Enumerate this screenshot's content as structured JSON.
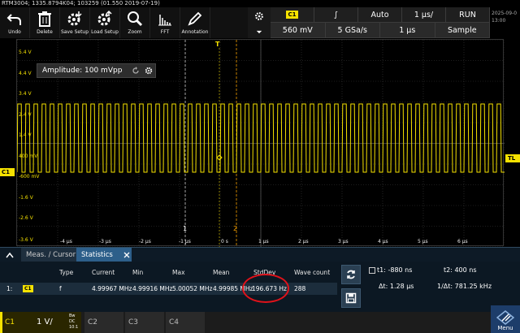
{
  "header": {
    "title": "RTM3004; 1335.8794K04; 103259 (01.550 2019-07-19)"
  },
  "toolbar": {
    "items": [
      {
        "label": "Undo",
        "icon": "undo-icon"
      },
      {
        "label": "Delete",
        "icon": "trash-icon"
      },
      {
        "label": "Save Setup",
        "icon": "save-setup-icon"
      },
      {
        "label": "Load Setup",
        "icon": "load-setup-icon"
      },
      {
        "label": "Zoom",
        "icon": "zoom-icon"
      },
      {
        "label": "FFT",
        "icon": "fft-icon"
      },
      {
        "label": "Annotation",
        "icon": "pen-icon"
      }
    ]
  },
  "settings": {
    "channel": "C1",
    "trigger_slope": "∫",
    "mode": "Auto",
    "time_per_div": "1 µs/",
    "run_state": "RUN",
    "vertical_scale": "560 mV",
    "sample_rate": "5 GSa/s",
    "record_time": "1 µs",
    "acq_mode": "Sample"
  },
  "date": {
    "line1": "2025-09-0",
    "line2": "13:00"
  },
  "plot": {
    "y_labels": [
      "5.4 V",
      "4.4 V",
      "3.4 V",
      "2.4 V",
      "1.4 V",
      "400 mV",
      "-600 mV",
      "-1.6 V",
      "-2.6 V",
      "-3.6 V"
    ],
    "x_labels": [
      "-4 µs",
      "-3 µs",
      "-2 µs",
      "-1 µs",
      "0 s",
      "1 µs",
      "2 µs",
      "3 µs",
      "4 µs",
      "5 µs",
      "6 µs"
    ],
    "channel_marker": "C1",
    "trigger_level_marker": "TL",
    "trigger_marker": "T",
    "cursor1_label": "1",
    "cursor2_label": "2",
    "colors": {
      "trace": "#f6e200",
      "grid": "#3a3a3a",
      "cursor": "#cccccc"
    }
  },
  "amplitude_popup": {
    "text": "Amplitude: 100 mVpp"
  },
  "measurement": {
    "tabs": [
      {
        "label": "Meas. / Cursor"
      },
      {
        "label": "Statistics"
      }
    ],
    "headers": [
      "Type",
      "Current",
      "Min",
      "Max",
      "Mean",
      "StdDev",
      "Wave count"
    ],
    "row": {
      "index": "1:",
      "channel": "C1",
      "type": "f",
      "current": "4.99967 MHz",
      "min": "4.99916 MHz",
      "max": "5.00052 MHz",
      "mean": "4.99985 MHz",
      "stddev": "196.673 Hz",
      "wave_count": "288"
    }
  },
  "cursor_info": {
    "t1": "t1: -880 ns",
    "t2": "t2: 400 ns",
    "dt": "Δt: 1.28 µs",
    "inv_dt": "1/Δt: 781.25 kHz"
  },
  "bottom": {
    "c1_name": "C1",
    "c1_scale": "1 V/",
    "c1_coupling_top": "Bw DC",
    "c1_coupling_bottom": "10:1",
    "c2": "C2",
    "c3": "C3",
    "c4": "C4",
    "menu_label": "Menu"
  }
}
